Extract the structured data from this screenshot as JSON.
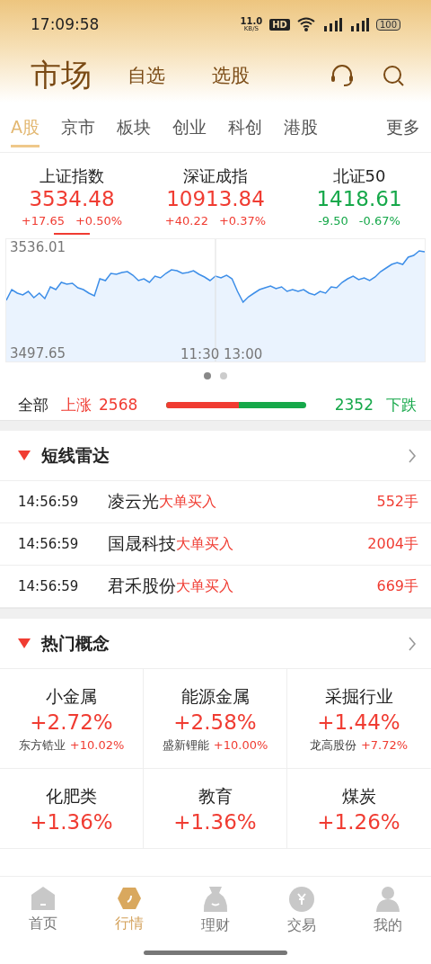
{
  "status_bar": {
    "time": "17:09:58",
    "net_speed": "11.0",
    "net_unit": "KB/S",
    "hd": "HD",
    "battery": "100"
  },
  "header": {
    "title": "市场",
    "tabs": [
      {
        "label": "自选",
        "selected": false
      },
      {
        "label": "选股",
        "selected": false
      }
    ]
  },
  "market_tabs": [
    {
      "label": "A股",
      "selected": true
    },
    {
      "label": "京市",
      "selected": false
    },
    {
      "label": "板块",
      "selected": false
    },
    {
      "label": "创业",
      "selected": false
    },
    {
      "label": "科创",
      "selected": false
    },
    {
      "label": "港股",
      "selected": false
    }
  ],
  "more": "更多",
  "indices": [
    {
      "name": "上证指数",
      "value": "3534.48",
      "change": "+17.65",
      "percent": "+0.50%",
      "kind": "up",
      "selected": true
    },
    {
      "name": "深证成指",
      "value": "10913.84",
      "change": "+40.22",
      "percent": "+0.37%",
      "kind": "up",
      "selected": false
    },
    {
      "name": "北证50",
      "value": "1418.61",
      "change": "-9.50",
      "percent": "-0.67%",
      "kind": "down",
      "selected": false
    }
  ],
  "intraday": {
    "high": "3536.01",
    "low": "3497.65",
    "time_labels": [
      "11:30",
      "13:00"
    ]
  },
  "pager": [
    {
      "selected": true
    },
    {
      "selected": false
    }
  ],
  "breadth": {
    "label": "全部",
    "up_label": "上涨",
    "up_count": "2568",
    "down_count": "2352",
    "down_label": "下跌",
    "level": 0.52
  },
  "radar": {
    "title": "短线雷达",
    "expanded": true,
    "rows": [
      {
        "time": "14:56:59",
        "stock": "凌云光",
        "signal": "大单买入",
        "volume": "552手"
      },
      {
        "time": "14:56:59",
        "stock": "国晟科技",
        "signal": "大单买入",
        "volume": "2004手"
      },
      {
        "time": "14:56:59",
        "stock": "君禾股份",
        "signal": "大单买入",
        "volume": "669手"
      }
    ]
  },
  "concepts": {
    "title": "热门概念",
    "expanded": true,
    "items": [
      {
        "name": "小金属",
        "percent": "+2.72%",
        "leader": "东方锆业",
        "leader_percent": "+10.02%"
      },
      {
        "name": "能源金属",
        "percent": "+2.58%",
        "leader": "盛新锂能",
        "leader_percent": "+10.00%"
      },
      {
        "name": "采掘行业",
        "percent": "+1.44%",
        "leader": "龙高股份",
        "leader_percent": "+7.72%"
      },
      {
        "name": "化肥类",
        "percent": "+1.36%"
      },
      {
        "name": "教育",
        "percent": "+1.36%"
      },
      {
        "name": "煤炭",
        "percent": "+1.26%"
      }
    ]
  },
  "bottom_nav": [
    {
      "label": "首页",
      "kind": "home",
      "selected": false
    },
    {
      "label": "行情",
      "kind": "market",
      "selected": true
    },
    {
      "label": "理财",
      "kind": "bag",
      "selected": false
    },
    {
      "label": "交易",
      "kind": "coin",
      "selected": false
    },
    {
      "label": "我的",
      "kind": "person",
      "selected": false
    }
  ]
}
